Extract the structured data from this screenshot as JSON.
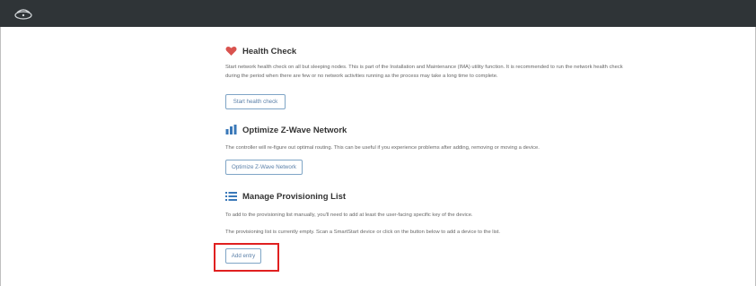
{
  "header": {
    "logo_icon": "hub-logo-icon"
  },
  "health_check": {
    "icon": "heart-icon",
    "title": "Health Check",
    "description": "Start network health check on all but sleeping nodes. This is part of the Installation and Maintenance (IMA) utility function. It is recommended to run the network health check during the period when there are few or no network activities running as the process may take a long time to complete.",
    "button_label": "Start health check"
  },
  "optimize": {
    "icon": "network-icon",
    "title": "Optimize Z-Wave Network",
    "description": "The controller will re-figure out optimal routing. This can be useful if you experience problems after adding, removing or moving a device.",
    "button_label": "Optimize Z-Wave Network"
  },
  "provisioning": {
    "icon": "list-icon",
    "title": "Manage Provisioning List",
    "description_1": "To add to the provisioning list manually, you'll need to add at least the user-facing specific key of the device.",
    "description_2": "The provisioning list is currently empty. Scan a SmartStart device or click on the button below to add a device to the list.",
    "button_label": "Add entry"
  },
  "colors": {
    "topbar": "#2f3437",
    "accent_blue": "#5a7fa8",
    "highlight_red": "#e02020",
    "heart_red": "#d9534f"
  }
}
